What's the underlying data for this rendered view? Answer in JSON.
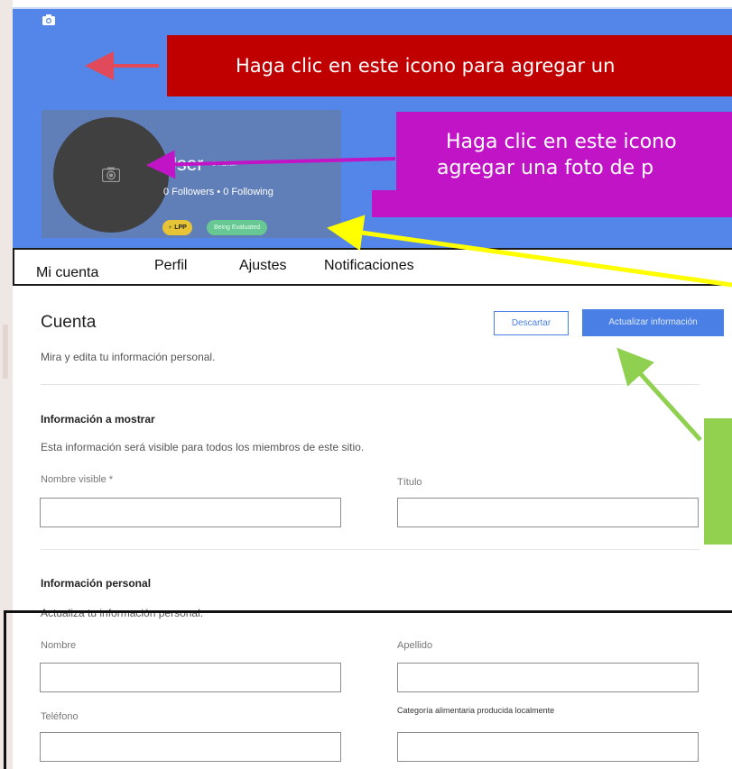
{
  "callouts": {
    "cover": "Haga clic en este icono para agregar un",
    "avatar_line1": "Haga clic en este icono",
    "avatar_line2": "agregar una foto de p"
  },
  "profile": {
    "username": "User",
    "role": "Admin",
    "followers": "0 Followers • 0 Following",
    "badge_lpp": "LPP",
    "badge_status": "Being Evaluated"
  },
  "tabs": [
    "Mi cuenta",
    "Perfil",
    "Ajustes",
    "Notificaciones"
  ],
  "account": {
    "title": "Cuenta",
    "description": "Mira y edita tu información personal.",
    "discard_label": "Descartar",
    "update_label": "Actualizar información"
  },
  "display_info": {
    "title": "Información a mostrar",
    "description": "Esta información será visible para todos los miembros de este sitio.",
    "display_name_label": "Nombre visible *",
    "title_label": "Título",
    "display_name_value": "",
    "title_value": ""
  },
  "personal_info": {
    "title": "Información personal",
    "description": "Actualiza tu información personal.",
    "first_name_label": "Nombre",
    "last_name_label": "Apellido",
    "phone_label": "Teléfono",
    "category_label": "Categoría alimentaria producida localmente",
    "first_name_value": "",
    "last_name_value": "",
    "phone_value": "",
    "category_value": ""
  },
  "colors": {
    "cover": "#5485e8",
    "accent": "#4a80e5",
    "callout_red": "#c00000",
    "callout_magenta": "#c214c7",
    "callout_green": "#92d050",
    "arrow_yellow": "#ffff00",
    "arrow_green": "#8fd050"
  },
  "icons": {
    "cover_camera": "camera-icon",
    "avatar_camera": "camera-icon",
    "lpp_badge": "lpp-logo-icon",
    "role_badge": "crown-icon"
  }
}
